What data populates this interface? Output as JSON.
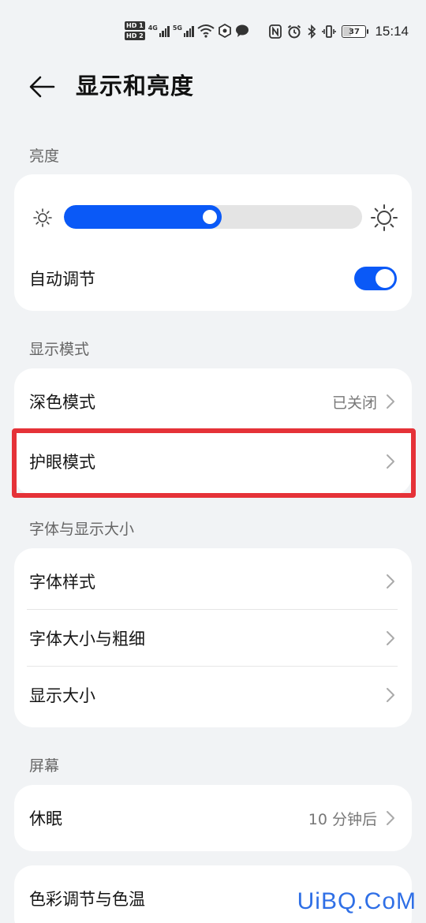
{
  "status_bar": {
    "sim1_badge": "HD 1",
    "sim2_badge": "HD 2",
    "net1": "4G",
    "net2": "5G",
    "battery_level": "37",
    "time": "15:14"
  },
  "header": {
    "title": "显示和亮度"
  },
  "brightness": {
    "section_label": "亮度",
    "level_percent": 53,
    "auto_adjust_label": "自动调节",
    "auto_adjust_on": true
  },
  "display_mode": {
    "section_label": "显示模式",
    "dark_mode_label": "深色模式",
    "dark_mode_value": "已关闭",
    "eye_comfort_label": "护眼模式"
  },
  "font_display": {
    "section_label": "字体与显示大小",
    "font_style_label": "字体样式",
    "font_size_label": "字体大小与粗细",
    "display_size_label": "显示大小"
  },
  "screen": {
    "section_label": "屏幕",
    "sleep_label": "休眠",
    "sleep_value": "10 分钟后",
    "color_label": "色彩调节与色温"
  },
  "watermark": "UiBQ.CoM",
  "colors": {
    "accent": "#0a59f7",
    "highlight": "#e53238",
    "background": "#f1f3f5"
  },
  "icons": [
    "back-arrow-icon",
    "sun-small-icon",
    "sun-large-icon",
    "chevron-right-icon"
  ]
}
